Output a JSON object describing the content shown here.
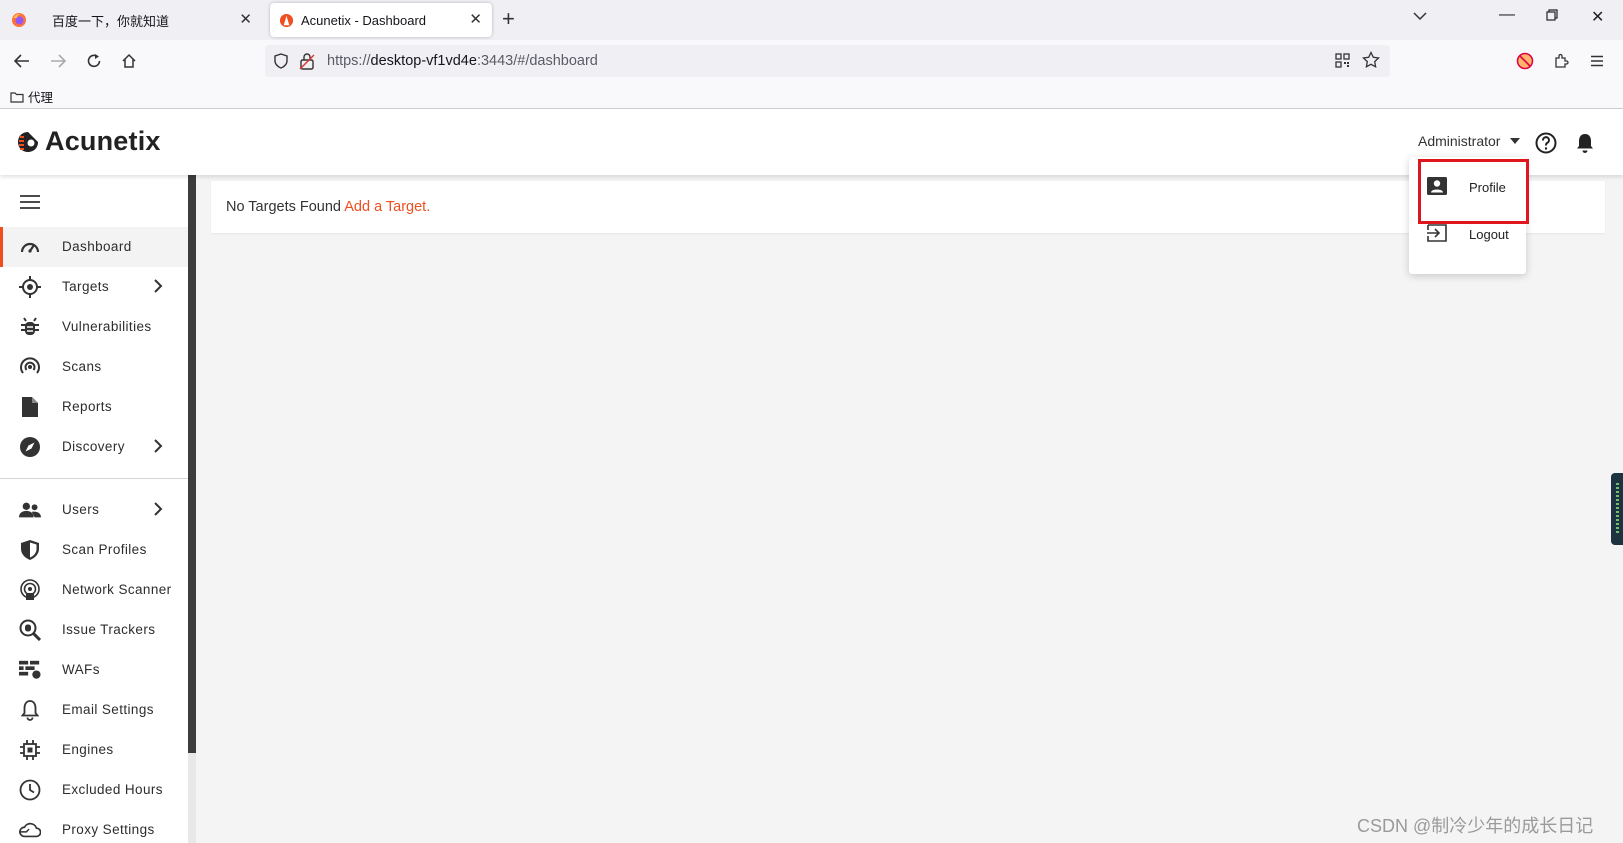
{
  "browser": {
    "tabs": [
      {
        "title": "百度一下，你就知道",
        "active": false
      },
      {
        "title": "Acunetix - Dashboard",
        "active": true
      }
    ],
    "url": {
      "scheme": "https://",
      "host": "desktop-vf1vd4e",
      "rest": ":3443/#/dashboard"
    },
    "bookmark": "代理"
  },
  "header": {
    "logo": "Acunetix",
    "user": "Administrator"
  },
  "sidebar": {
    "items": [
      {
        "label": "Dashboard",
        "icon": "dashboard-icon",
        "active": true
      },
      {
        "label": "Targets",
        "icon": "targets-icon",
        "chevron": true
      },
      {
        "label": "Vulnerabilities",
        "icon": "bug-icon"
      },
      {
        "label": "Scans",
        "icon": "scan-icon"
      },
      {
        "label": "Reports",
        "icon": "report-icon"
      },
      {
        "label": "Discovery",
        "icon": "compass-icon",
        "chevron": true
      },
      {
        "label": "Users",
        "icon": "users-icon",
        "chevron": true
      },
      {
        "label": "Scan Profiles",
        "icon": "shield-icon"
      },
      {
        "label": "Network Scanner",
        "icon": "network-scanner-icon"
      },
      {
        "label": "Issue Trackers",
        "icon": "issue-tracker-icon"
      },
      {
        "label": "WAFs",
        "icon": "firewall-icon"
      },
      {
        "label": "Email Settings",
        "icon": "bell-outline-icon"
      },
      {
        "label": "Engines",
        "icon": "chip-icon"
      },
      {
        "label": "Excluded Hours",
        "icon": "clock-icon"
      },
      {
        "label": "Proxy Settings",
        "icon": "cloud-icon"
      }
    ]
  },
  "main": {
    "empty_message": "No Targets Found",
    "add_link": "Add a Target."
  },
  "user_menu": {
    "items": [
      {
        "label": "Profile",
        "icon": "profile-icon"
      },
      {
        "label": "Logout",
        "icon": "logout-icon"
      }
    ]
  },
  "watermark": "CSDN @制冷少年的成长日记",
  "colors": {
    "accent": "#ef4e1f",
    "highlight": "#e0161f"
  }
}
